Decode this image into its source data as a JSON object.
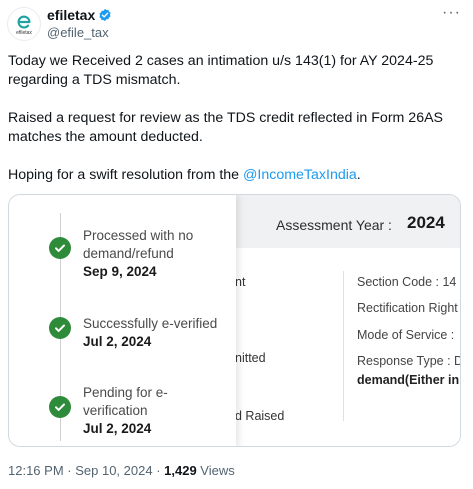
{
  "author": {
    "display_name": "efiletax",
    "handle": "@efile_tax",
    "avatar_text": "efiletax"
  },
  "tweet": {
    "paragraph1": "Today we Received 2 cases an intimation u/s 143(1) for AY 2024-25 regarding a TDS mismatch.",
    "paragraph2": "Raised a request for review as the TDS credit reflected in Form 26AS matches the amount deducted.",
    "paragraph3_prefix": "Hoping for a swift resolution from the ",
    "mention": "@IncomeTaxIndia",
    "paragraph3_suffix": "."
  },
  "screenshot": {
    "assessment_year_label": "Assessment Year :",
    "assessment_year_value": "2024",
    "fragments": {
      "f1": "nt",
      "f2": "nitted",
      "f3": "d Raised"
    },
    "right_col": {
      "section_code": "Section Code : 14",
      "rectification": "Rectification Right",
      "mode_of_service": "Mode of Service :",
      "response_type": "Response Type : D",
      "response_detail": "demand(Either in F"
    },
    "timeline": [
      {
        "status_line1": "Processed with no",
        "status_line2": "demand/refund",
        "date": "Sep 9, 2024"
      },
      {
        "status_line1": "Successfully e-verified",
        "status_line2": "",
        "date": "Jul 2, 2024"
      },
      {
        "status_line1": "Pending for e-",
        "status_line2": "verification",
        "date": "Jul 2, 2024"
      }
    ]
  },
  "meta": {
    "time": "12:16 PM",
    "separator": " · ",
    "date": "Sep 10, 2024",
    "views_count": "1,429",
    "views_label": " Views"
  },
  "colors": {
    "accent": "#1d9bf0",
    "check_green": "#2e8b3a"
  }
}
